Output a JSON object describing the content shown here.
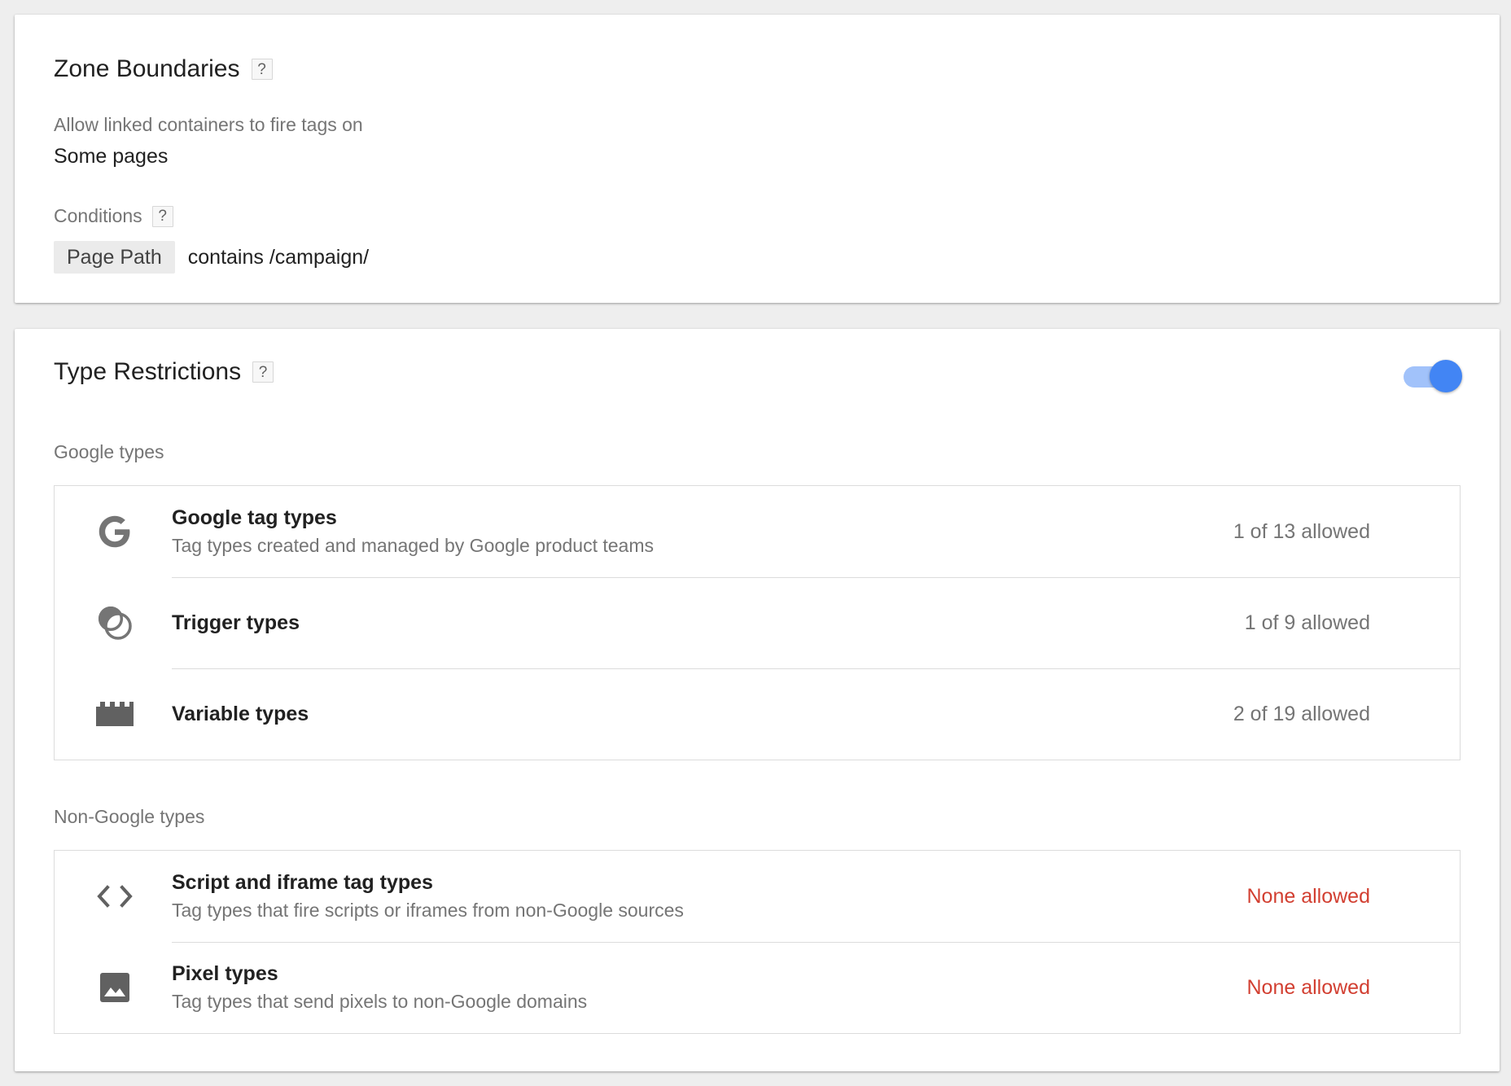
{
  "zone_boundaries": {
    "title": "Zone Boundaries",
    "help": "?",
    "fire_label": "Allow linked containers to fire tags on",
    "fire_value": "Some pages",
    "conditions_label": "Conditions",
    "conditions_help": "?",
    "condition": {
      "variable": "Page Path",
      "operator_value": "contains /campaign/"
    }
  },
  "type_restrictions": {
    "title": "Type Restrictions",
    "help": "?",
    "toggle_on": true,
    "colors": {
      "toggle_thumb": "#4285f4",
      "toggle_track": "#a1c2fa",
      "none_allowed": "#d23f31"
    },
    "google_types": {
      "label": "Google types",
      "rows": [
        {
          "icon": "google-g-icon",
          "title": "Google tag types",
          "description": "Tag types created and managed by Google product teams",
          "status": "1 of 13 allowed"
        },
        {
          "icon": "trigger-icon",
          "title": "Trigger types",
          "description": "",
          "status": "1 of 9 allowed"
        },
        {
          "icon": "variable-block-icon",
          "title": "Variable types",
          "description": "",
          "status": "2 of 19 allowed"
        }
      ]
    },
    "non_google_types": {
      "label": "Non-Google types",
      "rows": [
        {
          "icon": "code-icon",
          "title": "Script and iframe tag types",
          "description": "Tag types that fire scripts or iframes from non-Google sources",
          "status": "None allowed"
        },
        {
          "icon": "image-icon",
          "title": "Pixel types",
          "description": "Tag types that send pixels to non-Google domains",
          "status": "None allowed"
        }
      ]
    }
  }
}
